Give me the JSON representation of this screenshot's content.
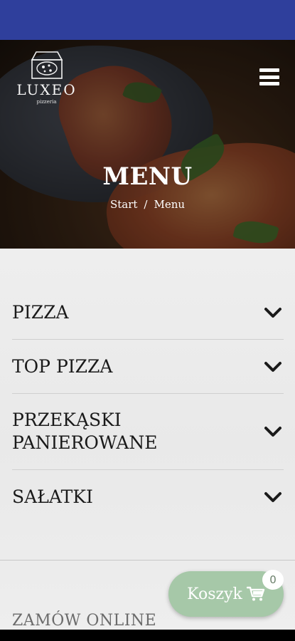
{
  "brand": {
    "name": "LUXEO",
    "subtitle": "pizzeria"
  },
  "header": {
    "title": "MENU",
    "breadcrumb": {
      "start": "Start",
      "separator": "/",
      "current": "Menu"
    },
    "menu_icon": "hamburger-icon"
  },
  "categories": [
    {
      "label": "PIZZA",
      "icon": "chevron-down-icon"
    },
    {
      "label": "TOP PIZZA",
      "icon": "chevron-down-icon"
    },
    {
      "label": "PRZEKĄSKI PANIEROWANE",
      "icon": "chevron-down-icon"
    },
    {
      "label": "SAŁATKI",
      "icon": "chevron-down-icon"
    }
  ],
  "order_section": {
    "title": "ZAMÓW ONLINE"
  },
  "cart": {
    "label": "Koszyk",
    "count": "0",
    "icon": "cart-icon"
  },
  "colors": {
    "status_bar": "#2f3f9c",
    "cart_button": "#a6c8a8",
    "text_dark": "#1a1a1a"
  }
}
